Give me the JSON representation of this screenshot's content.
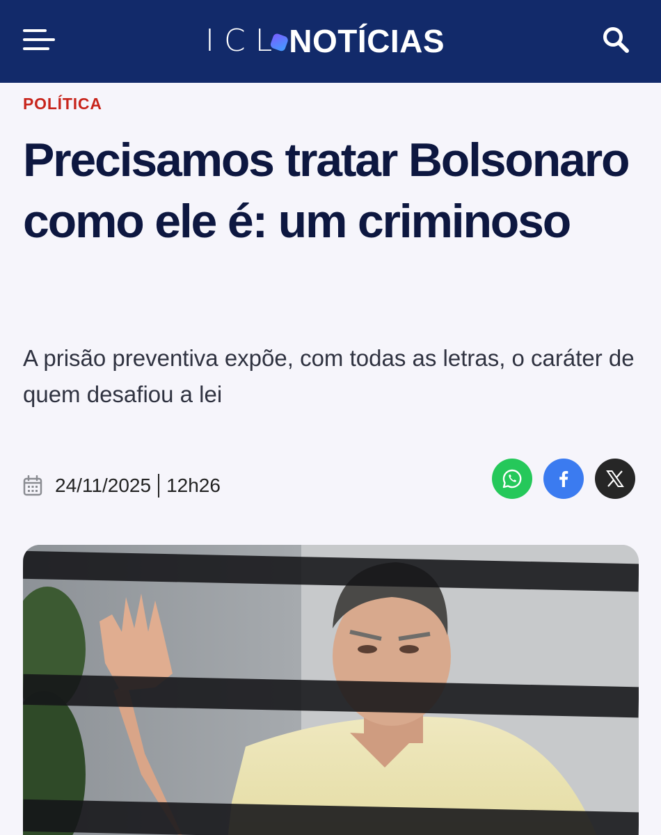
{
  "header": {
    "logo_left": "ICL",
    "logo_right": "NOTÍCIAS",
    "menu_icon": "hamburger-menu-icon",
    "search_icon": "search-icon",
    "background": "#122a6a"
  },
  "article": {
    "category": "POLÍTICA",
    "headline": "Precisamos tratar Bolsonaro como ele é: um criminoso",
    "subtitle": "A prisão preventiva expõe, com todas as letras, o caráter de quem desafiou a lei",
    "date": "24/11/2025",
    "time": "12h26",
    "category_color": "#c8251c",
    "headline_color": "#0d1740"
  },
  "share": {
    "whatsapp_icon": "whatsapp-icon",
    "facebook_icon": "facebook-icon",
    "x_icon": "x-twitter-icon",
    "colors": {
      "whatsapp": "#25c85a",
      "facebook": "#3b7bf0",
      "x": "#262626"
    }
  },
  "photo": {
    "icon": "article-photo",
    "description_hidden": true
  }
}
